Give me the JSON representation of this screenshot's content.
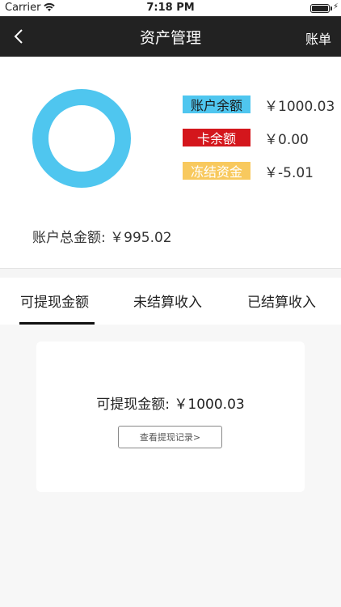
{
  "status_bar": {
    "carrier": "Carrier",
    "time": "7:18 PM",
    "battery_percent": 100
  },
  "nav": {
    "title": "资产管理",
    "right_label": "账单",
    "back_icon": "chevron-left-icon"
  },
  "summary": {
    "donut_color": "#4fc6ef",
    "legend": [
      {
        "label": "账户余额",
        "value": "￥1000.03",
        "color": "#4fc6ef"
      },
      {
        "label": "卡余额",
        "value": "￥0.00",
        "color": "#d4161c"
      },
      {
        "label": "冻结资金",
        "value": "￥-5.01",
        "color": "#f8c95e"
      }
    ],
    "total": "账户总金额: ￥995.02"
  },
  "tabs": [
    {
      "label": "可提现金额",
      "active": true
    },
    {
      "label": "未结算收入",
      "active": false
    },
    {
      "label": "已结算收入",
      "active": false
    }
  ],
  "card": {
    "amount_text": "可提现金额: ￥1000.03",
    "record_button": "查看提现记录>"
  }
}
